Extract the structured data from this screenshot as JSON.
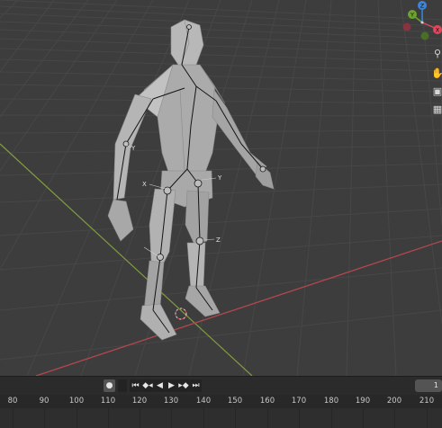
{
  "viewport": {
    "gizmo": {
      "x_label": "X",
      "y_label": "Y",
      "z_label": "Z",
      "colors": {
        "x": "#e0475b",
        "y": "#6ba32b",
        "z": "#3a85de",
        "neg_x": "#8a3340",
        "neg_y": "#4b6e27"
      }
    },
    "nav_icons": [
      "zoom-icon",
      "pan-hand-icon",
      "camera-icon",
      "grid-view-icon"
    ],
    "axis_labels": {
      "x_marker": "X",
      "z_marker": "Z",
      "y_marker": "Y"
    },
    "colors": {
      "background": "#3d3d3d",
      "x_axis": "#b3474f",
      "y_axis": "#7f9c3e",
      "mesh": "#b4b4b4",
      "bone": "#1a1a1a"
    }
  },
  "timeline": {
    "current_frame": "1",
    "ticks": [
      "80",
      "90",
      "100",
      "110",
      "120",
      "130",
      "140",
      "150",
      "160",
      "170",
      "180",
      "190",
      "200",
      "210"
    ],
    "visible_ticks": [
      "80",
      "90",
      "100",
      "110",
      "120",
      "130",
      "140",
      "150",
      "160",
      "170",
      "180",
      "190",
      "200",
      "210"
    ],
    "tick_display": [
      "80",
      "90",
      "100",
      "110",
      "120",
      "130",
      "140",
      "150",
      "160",
      "170",
      "180",
      "190",
      "200",
      "210"
    ],
    "controls": {
      "keyframe": "●",
      "jump_start": "⏮",
      "prev_key": "◆◂",
      "play_reverse": "◀",
      "play": "▶",
      "next_key": "▸◆",
      "jump_end": "⏭"
    }
  }
}
